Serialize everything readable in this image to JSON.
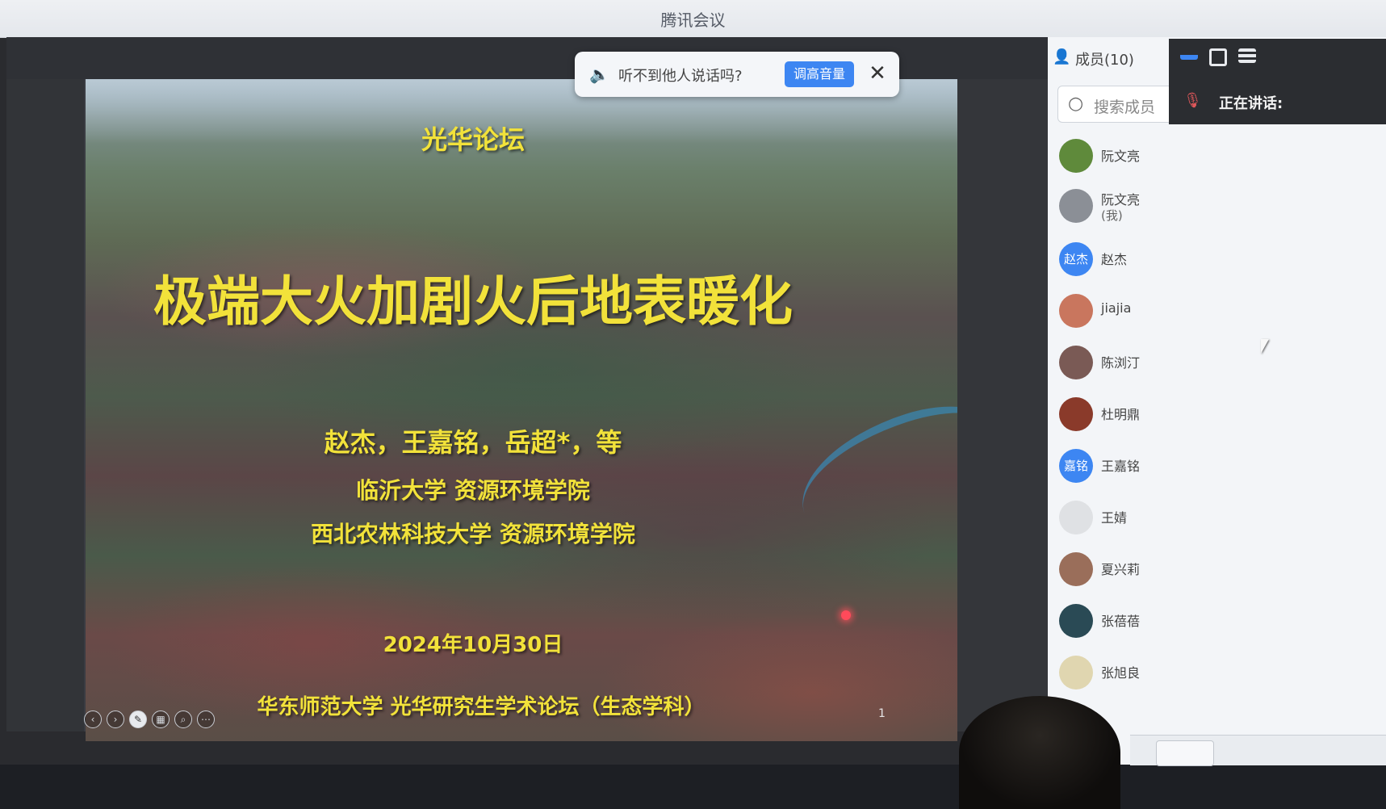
{
  "app": {
    "title": "腾讯会议"
  },
  "notice": {
    "message": "听不到他人说话吗?",
    "button_label": "调高音量",
    "close_glyph": "✕",
    "icon": "speaker-muted-icon",
    "accent": "#3d86f2"
  },
  "slide": {
    "forum": "光华论坛",
    "title": "极端大火加剧火后地表暖化",
    "authors": "赵杰，王嘉铭，岳超*，等",
    "affiliation_1": "临沂大学 资源环境学院",
    "affiliation_2": "西北农林科技大学 资源环境学院",
    "date": "2024年10月30日",
    "footer": "华东师范大学 光华研究生学术论坛（生态学科）",
    "page_number": "1",
    "text_color": "#f2e23a"
  },
  "members_panel": {
    "header": "成员(10)",
    "search_placeholder": "搜索成员",
    "members": [
      {
        "name": "阮文亮",
        "sub": "",
        "avatar_text": ""
      },
      {
        "name": "阮文亮",
        "sub": "(我)",
        "avatar_text": ""
      },
      {
        "name": "赵杰",
        "sub": "",
        "avatar_text": "赵杰"
      },
      {
        "name": "jiajia",
        "sub": "",
        "avatar_text": ""
      },
      {
        "name": "陈浏汀",
        "sub": "",
        "avatar_text": ""
      },
      {
        "name": "杜明鼎",
        "sub": "",
        "avatar_text": ""
      },
      {
        "name": "王嘉铭",
        "sub": "",
        "avatar_text": "嘉铭"
      },
      {
        "name": "王婧",
        "sub": "",
        "avatar_text": ""
      },
      {
        "name": "夏兴莉",
        "sub": "",
        "avatar_text": ""
      },
      {
        "name": "张蓓蓓",
        "sub": "",
        "avatar_text": ""
      },
      {
        "name": "张旭良",
        "sub": "",
        "avatar_text": ""
      }
    ]
  },
  "speaking": {
    "label": "正在讲话:",
    "mic_icon": "mic-muted-icon"
  }
}
